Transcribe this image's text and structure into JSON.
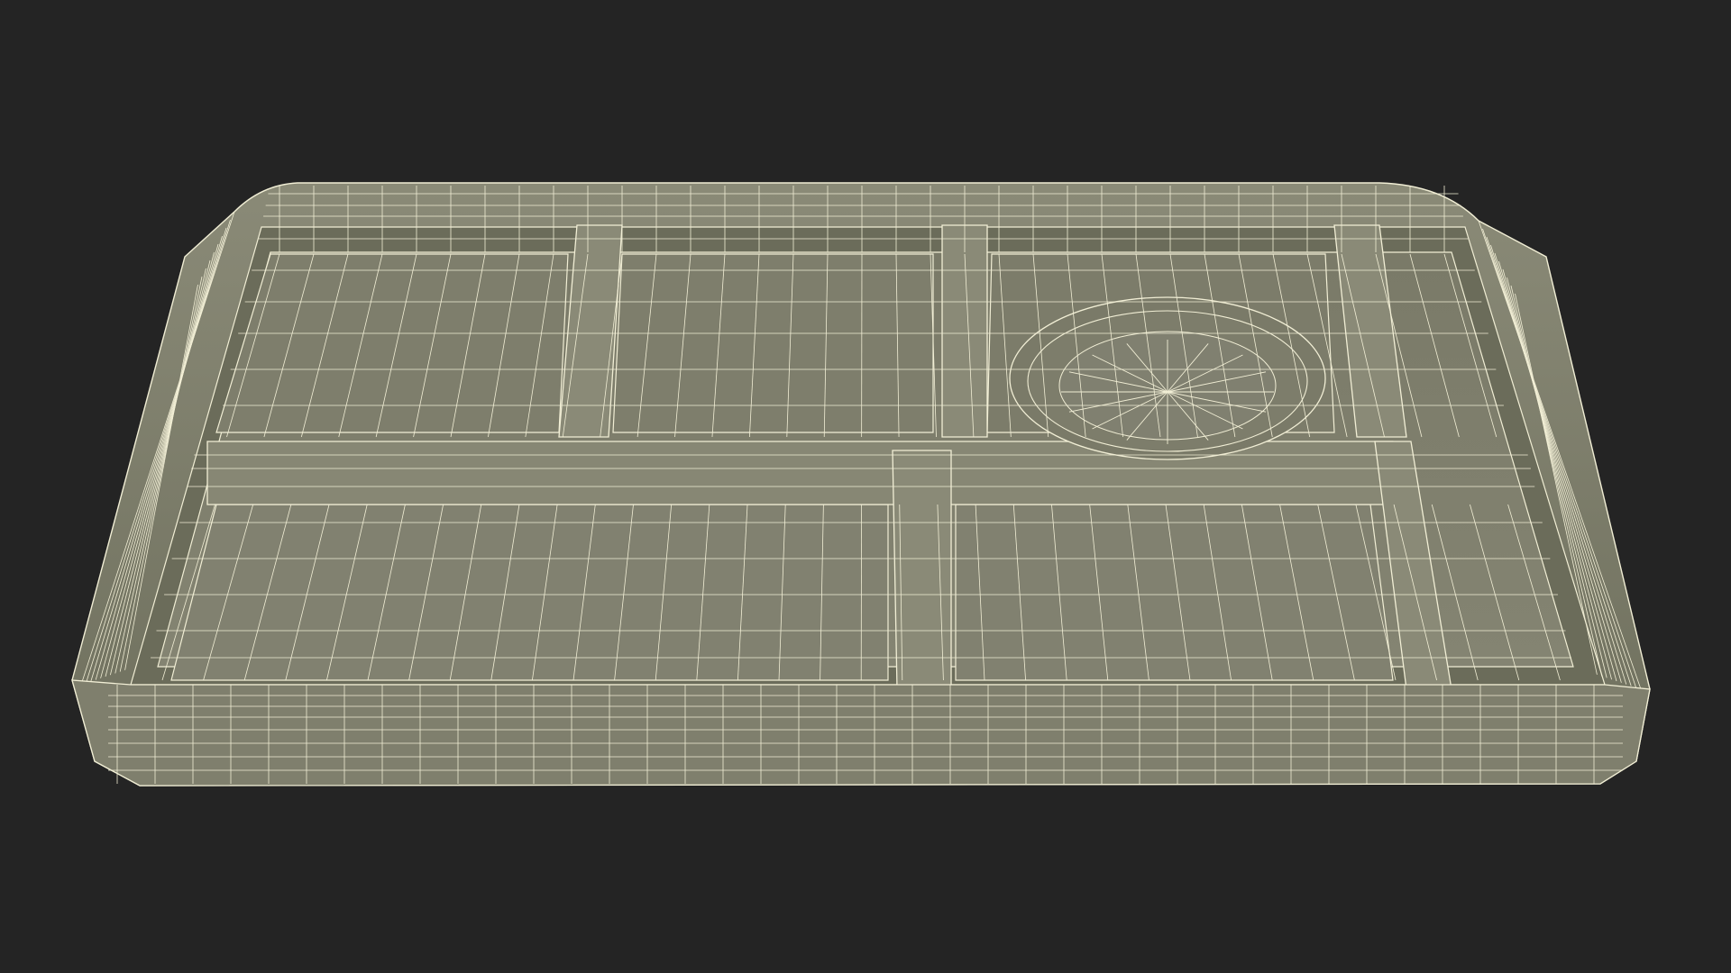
{
  "scene": {
    "background_color": "#242424",
    "subject": "divided-tray-wireframe",
    "mesh_fill_color": "#7d7d6c",
    "mesh_shadow_color": "#5f604f",
    "mesh_highlight_color": "#8c8c7a",
    "wire_color": "#f1eed5",
    "compartment_count": 5,
    "has_round_recess": true
  }
}
